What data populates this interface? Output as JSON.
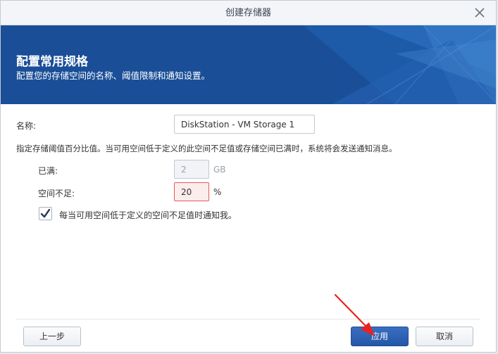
{
  "window": {
    "title": "创建存储器",
    "close_icon": "close-icon"
  },
  "banner": {
    "heading": "配置常用规格",
    "subheading": "配置您的存储空间的名称、阈值限制和通知设置。",
    "color": "#1a4f98"
  },
  "form": {
    "name_label": "名称:",
    "name_value": "DiskStation - VM Storage 1",
    "threshold_description": "指定存储阈值百分比值。当可用空间低于定义的此空间不足值或存储空间已满时，系统将会发送通知消息。",
    "full_label": "已满:",
    "full_value": "2",
    "full_unit": "GB",
    "low_space_label": "空间不足:",
    "low_space_value": "20",
    "low_space_unit": "%",
    "notify_checked": true,
    "notify_label": "每当可用空间低于定义的空间不足值时通知我。"
  },
  "footer": {
    "back_label": "上一步",
    "apply_label": "应用",
    "cancel_label": "取消",
    "primary_color": "#2557a8"
  },
  "annotation": {
    "arrow_color": "#e8231f"
  }
}
